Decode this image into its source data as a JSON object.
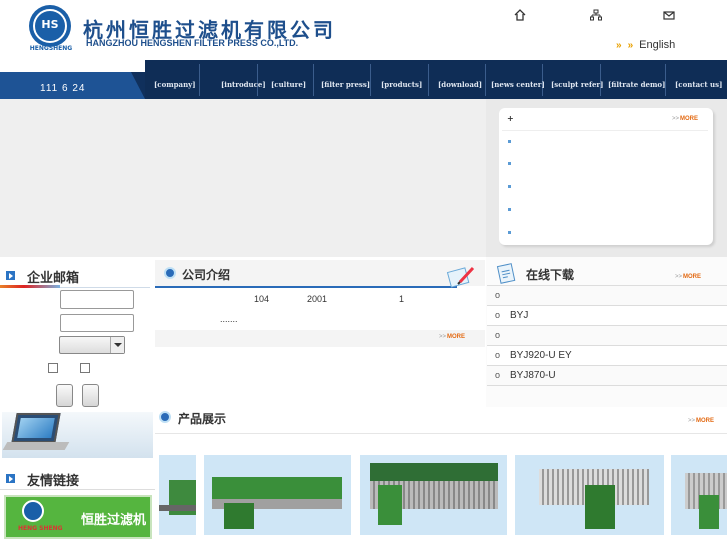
{
  "header": {
    "logo_text": "HS",
    "logo_caption": "HENGSHENG",
    "company_cn": "杭州恒胜过滤机有限公司",
    "company_en": "HANGZHOU HENGSHEN FILTER PRESS CO.,LTD.",
    "icons": [
      "home-icon",
      "sitemap-icon",
      "contact-icon"
    ],
    "language": "English"
  },
  "nav": {
    "date": "111 6 24",
    "items": [
      "[company]",
      "[introduce]",
      "[culture]",
      "[filter press]",
      "[products]",
      "[download]",
      "[news center]",
      "[sculpt refer]",
      "[filtrate demo]",
      "[contact us]"
    ]
  },
  "news": {
    "title": "+",
    "more": "MORE",
    "more_prefix": ">>"
  },
  "left": {
    "mail_title": "企业邮箱",
    "links_title": "友情链接",
    "partner_text": "恒胜过滤机",
    "partner_caption": "HENG SHENG"
  },
  "intro": {
    "title": "公司介绍",
    "line1_a": "104",
    "line1_b": "2001",
    "line1_c": "1",
    "line2": ".......",
    "more": "MORE",
    "more_prefix": ">>"
  },
  "download": {
    "title": "在线下载",
    "more": "MORE",
    "more_prefix": ">>",
    "items": [
      {
        "bullet": "o",
        "text": ""
      },
      {
        "bullet": "o",
        "text": "BYJ"
      },
      {
        "bullet": "o",
        "text": ""
      },
      {
        "bullet": "o",
        "text": "BYJ920-U  EY"
      },
      {
        "bullet": "o",
        "text": "BYJ870-U"
      }
    ]
  },
  "products": {
    "title": "产品展示",
    "more": "MORE",
    "more_prefix": ">>"
  }
}
